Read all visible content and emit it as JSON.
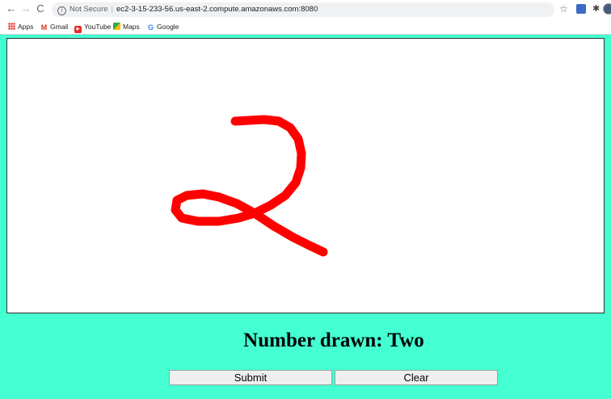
{
  "browser": {
    "back_icon": "back-arrow-icon",
    "forward_icon": "forward-arrow-icon",
    "reload_icon": "reload-icon",
    "security_label": "Not Secure",
    "url": "ec2-3-15-233-56.us-east-2.compute.amazonaws.com:8080",
    "bookmarks": [
      {
        "label": "Apps",
        "icon": "apps-grid-icon"
      },
      {
        "label": "Gmail",
        "icon": "gmail-icon"
      },
      {
        "label": "YouTube",
        "icon": "youtube-icon"
      },
      {
        "label": "Maps",
        "icon": "maps-icon"
      },
      {
        "label": "Google",
        "icon": "google-icon"
      }
    ]
  },
  "drawing": {
    "stroke_color": "#ff0000",
    "description_of_content": "handwritten digit"
  },
  "result": {
    "heading": "Number drawn: Two"
  },
  "buttons": {
    "submit_label": "Submit",
    "clear_label": "Clear"
  },
  "colors": {
    "page_background": "#44ffd2",
    "canvas_background": "#ffffff"
  }
}
